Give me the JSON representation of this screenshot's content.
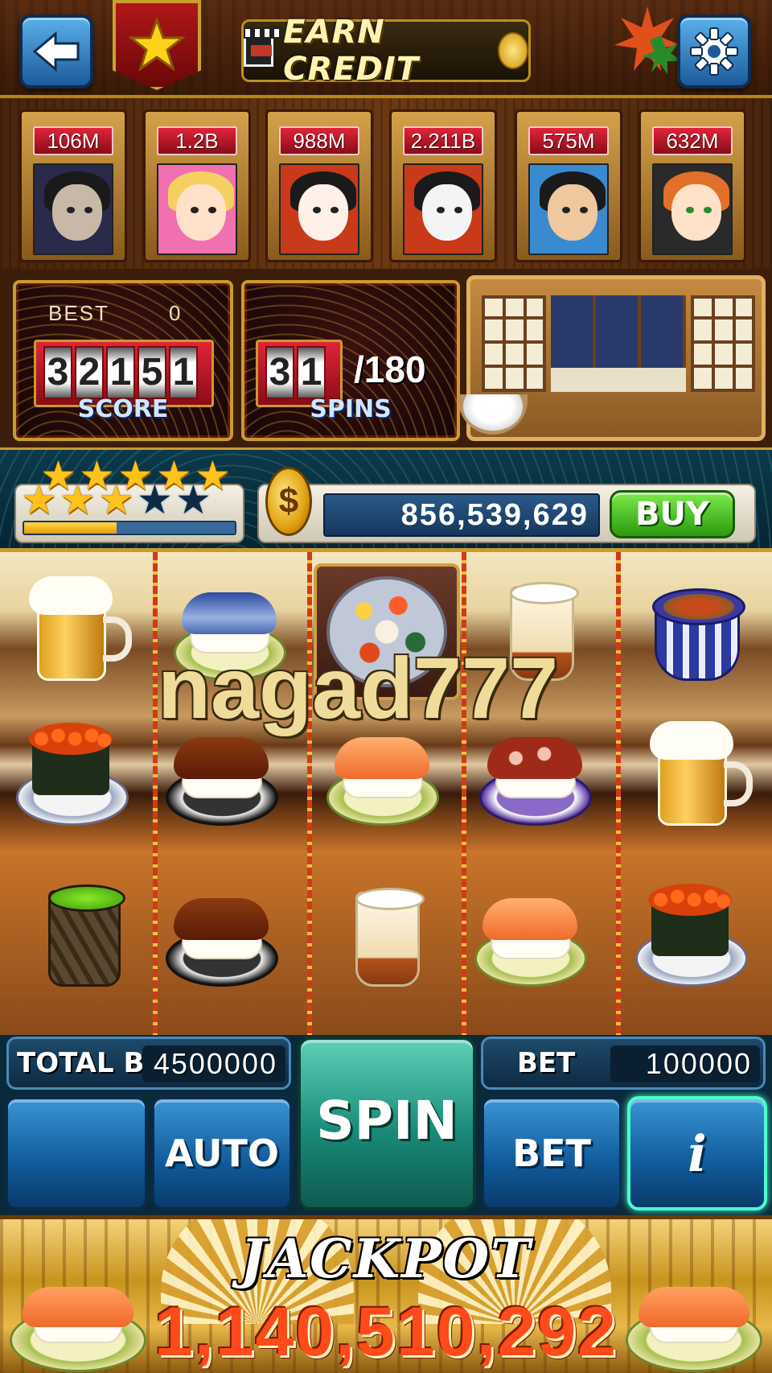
{
  "header": {
    "back_icon": "arrow-left-icon",
    "settings_icon": "gear-icon",
    "rank_icon": "star-icon",
    "earn_credit_label": "EARN CREDIT"
  },
  "players": [
    {
      "score": "106M",
      "avatar": "vampire-avatar"
    },
    {
      "score": "1.2B",
      "avatar": "blonde-woman-avatar"
    },
    {
      "score": "988M",
      "avatar": "geisha-avatar"
    },
    {
      "score": "2.211B",
      "avatar": "panda-avatar"
    },
    {
      "score": "575M",
      "avatar": "cap-boy-avatar"
    },
    {
      "score": "632M",
      "avatar": "redhead-woman-avatar"
    }
  ],
  "score_panel": {
    "best_label": "BEST",
    "best_value": "0",
    "score_digits": [
      "3",
      "2",
      "1",
      "5",
      "1"
    ],
    "label": "SCORE"
  },
  "spins_panel": {
    "spins_digits": [
      "3",
      "1"
    ],
    "total": "/180",
    "label": "SPINS"
  },
  "level": {
    "stars_filled": 8,
    "stars_total": 10,
    "xp_progress": 0.44
  },
  "wallet": {
    "credits": "856,539,629",
    "buy_label": "BUY"
  },
  "reels": {
    "watermark": "nagad777",
    "rows": [
      [
        "beer-mug",
        "mackerel-sushi",
        "bonus-sushi-platter",
        "sake-cup",
        "chawanmushi-bowl"
      ],
      [
        "salmon-roe-sushi",
        "eel-sushi",
        "shrimp-sushi",
        "octopus-sushi",
        "beer-mug"
      ],
      [
        "matcha-tea-cup",
        "eel-sushi",
        "sake-cup",
        "shrimp-sushi",
        "salmon-roe-sushi"
      ]
    ]
  },
  "controls": {
    "total_bet_label": "TOTAL BET",
    "total_bet_value": "4500000",
    "bet_label": "BET",
    "bet_value": "100000",
    "blank_button_label": "",
    "auto_label": "AUTO",
    "spin_label": "SPIN",
    "bet_button_label": "BET",
    "info_label": "i"
  },
  "jackpot": {
    "title": "JACKPOT",
    "value": "1,140,510,292"
  },
  "colors": {
    "accent_gold": "#c99a2e",
    "buy_green": "#2a9a10",
    "spin_teal": "#1a8a78",
    "jackpot_red": "#ff4a1a"
  }
}
